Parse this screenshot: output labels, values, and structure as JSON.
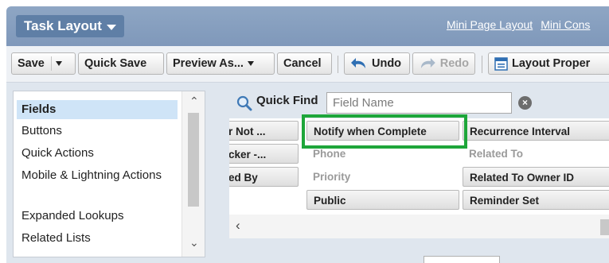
{
  "header": {
    "title": "Task Layout",
    "links": [
      "Mini Page Layout",
      "Mini Cons"
    ]
  },
  "toolbar": {
    "save": "Save",
    "quick_save": "Quick Save",
    "preview_as": "Preview As...",
    "cancel": "Cancel",
    "undo": "Undo",
    "redo": "Redo",
    "layout_properties": "Layout Proper"
  },
  "palette": {
    "categories": [
      "Fields",
      "Buttons",
      "Quick Actions",
      "Mobile & Lightning Actions",
      "Expanded Lookups",
      "Related Lists"
    ],
    "selected": "Fields"
  },
  "quick_find": {
    "label": "Quick Find",
    "placeholder": "Field Name"
  },
  "fields": {
    "col1": [
      "r Not ...",
      "cker -...",
      "ed By"
    ],
    "col2": [
      "Notify when Complete",
      "Phone",
      "Priority",
      "Public"
    ],
    "col3": [
      "Recurrence Interval",
      "Related To",
      "Related To Owner ID",
      "Reminder Set"
    ]
  },
  "colors": {
    "highlight": "#1ea63a",
    "header_bg": "#8ea6c4",
    "selected_bg": "#cfe4f7"
  }
}
